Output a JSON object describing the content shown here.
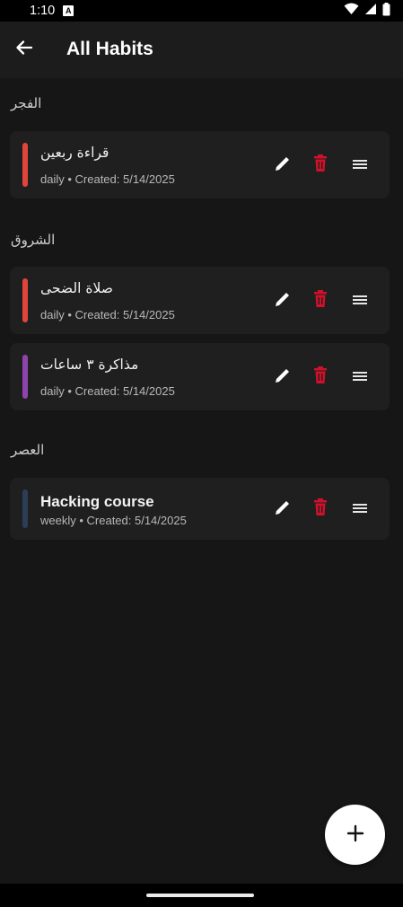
{
  "status_bar": {
    "time": "1:10",
    "notification_badge": "A",
    "icons": [
      "wifi-icon",
      "signal-icon",
      "battery-icon"
    ]
  },
  "app_bar": {
    "title": "All Habits",
    "back_icon": "arrow-back-icon"
  },
  "sections": [
    {
      "title": "الفجر",
      "habits": [
        {
          "name": "قراءة ربعين",
          "meta": "daily • Created: 5/14/2025",
          "color": "#e0453b"
        }
      ]
    },
    {
      "title": "الشروق",
      "habits": [
        {
          "name": "صلاة الضحى",
          "meta": "daily • Created: 5/14/2025",
          "color": "#e0453b"
        },
        {
          "name": "مذاكرة ٣ ساعات",
          "meta": "daily • Created: 5/14/2025",
          "color": "#8e44ad"
        }
      ]
    },
    {
      "title": "العصر",
      "habits": [
        {
          "name": "Hacking course",
          "meta": "weekly • Created: 5/14/2025",
          "color": "#2c3e55"
        }
      ]
    }
  ],
  "actions": {
    "edit_icon": "pencil-icon",
    "delete_icon": "trash-icon",
    "drag_icon": "drag-handle-icon",
    "delete_color": "#d0112b"
  },
  "fab": {
    "icon": "plus-icon"
  }
}
